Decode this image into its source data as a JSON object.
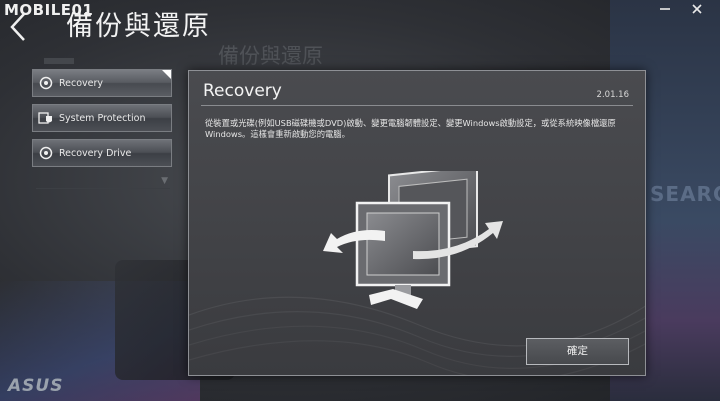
{
  "brand": {
    "watermark": "MOBILE01",
    "asus": "ASUS"
  },
  "header": {
    "title": "備份與還原",
    "minimize_icon": "minimize-icon",
    "close_icon": "close-icon"
  },
  "background": {
    "heading": "備份與還原",
    "search": "SEARCH"
  },
  "sidebar": {
    "items": [
      {
        "label": "Recovery",
        "icon": "recovery-icon",
        "active": true
      },
      {
        "label": "System Protection",
        "icon": "system-protection-icon",
        "active": false
      },
      {
        "label": "Recovery Drive",
        "icon": "recovery-drive-icon",
        "active": false
      }
    ]
  },
  "dialog": {
    "title": "Recovery",
    "version": "2.01.16",
    "description": "從裝置或光碟(例如USB磁碟機或DVD)啟動、變更電腦韌體設定、變更Windows啟動設定，或從系統映像檔還原Windows。這樣會重新啟動您的電腦。",
    "ok_label": "確定",
    "illustration_icon": "monitor-restart-illustration"
  }
}
